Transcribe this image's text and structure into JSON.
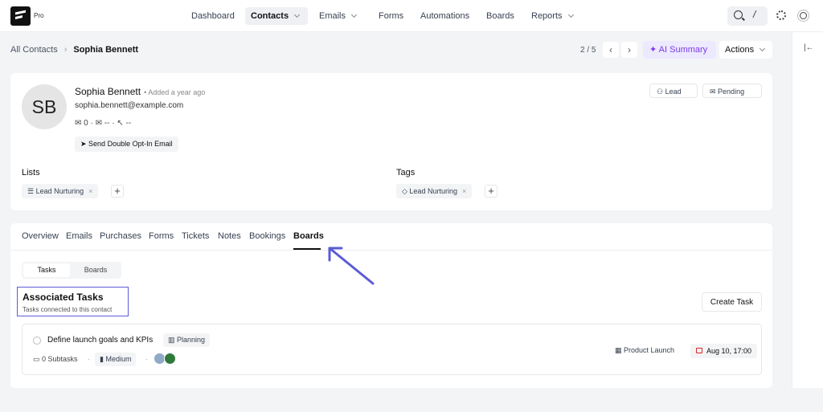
{
  "app": {
    "badge": "Pro"
  },
  "nav": {
    "items": [
      "Dashboard",
      "Contacts",
      "Emails",
      "Forms",
      "Automations",
      "Boards",
      "Reports"
    ],
    "active": "Contacts",
    "search_hint": "/"
  },
  "breadcrumb": {
    "parent": "All Contacts",
    "current": "Sophia Bennett"
  },
  "pager": {
    "position": "2 / 5"
  },
  "toolbar": {
    "ai_summary": "AI Summary",
    "actions": "Actions"
  },
  "contact": {
    "initials": "SB",
    "name": "Sophia Bennett",
    "added": "• Added a year ago",
    "email": "sophia.bennett@example.com",
    "emails_count": "0",
    "opens": "--",
    "clicks": "--",
    "double_optin": "Send Double Opt-In Email",
    "type": "Lead",
    "status": "Pending"
  },
  "lists": {
    "heading": "Lists",
    "items": [
      "Lead Nurturing"
    ]
  },
  "tags": {
    "heading": "Tags",
    "items": [
      "Lead Nurturing"
    ]
  },
  "tabs": [
    "Overview",
    "Emails",
    "Purchases",
    "Forms",
    "Tickets",
    "Notes",
    "Bookings",
    "Boards"
  ],
  "active_tab": "Boards",
  "segment": {
    "tasks": "Tasks",
    "boards": "Boards"
  },
  "associated": {
    "title": "Associated Tasks",
    "subtitle": "Tasks connected to this contact",
    "create": "Create Task"
  },
  "task": {
    "title": "Define launch goals and KPIs",
    "stage": "Planning",
    "subtasks": "0 Subtasks",
    "priority": "Medium",
    "board": "Product Launch",
    "due": "Aug 10, 17:00"
  },
  "colors": {
    "accent": "#7c3aed",
    "annotation": "#5b5bd6"
  }
}
